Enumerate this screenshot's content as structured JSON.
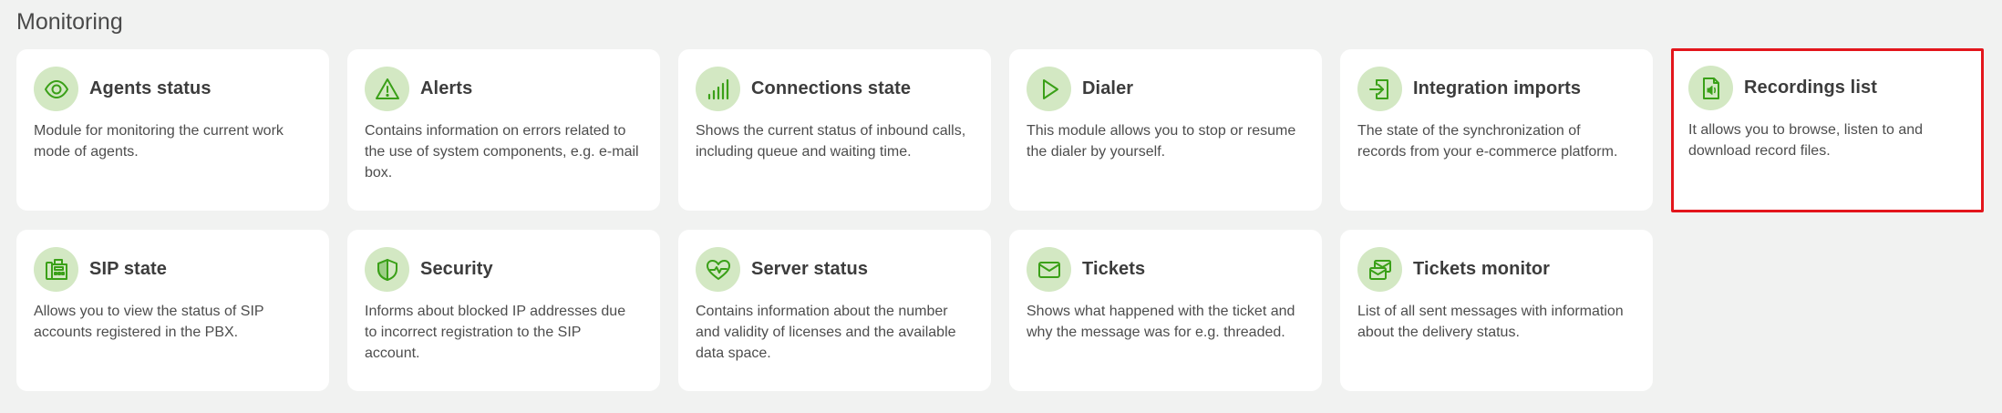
{
  "page": {
    "title": "Monitoring"
  },
  "accent_color": "#3aa018",
  "icon_bg_color": "#d3e8c3",
  "highlight_color": "#e3161c",
  "cards": [
    {
      "title": "Agents status",
      "icon": "eye-icon",
      "description": "Module for monitoring the current work mode of agents."
    },
    {
      "title": "Alerts",
      "icon": "warning-triangle-icon",
      "description": "Contains information on errors related to the use of system components, e.g. e-mail box."
    },
    {
      "title": "Connections state",
      "icon": "signal-bars-icon",
      "description": "Shows the current status of inbound calls, including queue and waiting time."
    },
    {
      "title": "Dialer",
      "icon": "play-icon",
      "description": "This module allows you to stop or resume the dialer by yourself."
    },
    {
      "title": "Integration imports",
      "icon": "import-icon",
      "description": "The state of the synchronization of records from your e-commerce platform."
    },
    {
      "title": "Recordings list",
      "icon": "audio-file-icon",
      "description": "It allows you to browse, listen to and download record files."
    },
    {
      "title": "SIP state",
      "icon": "fax-icon",
      "description": "Allows you to view the status of SIP accounts registered in the PBX."
    },
    {
      "title": "Security",
      "icon": "shield-icon",
      "description": "Informs about blocked IP addresses due to incorrect registration to the SIP account."
    },
    {
      "title": "Server status",
      "icon": "heart-pulse-icon",
      "description": "Contains information about the number and validity of licenses and the available data space."
    },
    {
      "title": "Tickets",
      "icon": "envelope-icon",
      "description": "Shows what happened with the ticket and why the message was for e.g. threaded."
    },
    {
      "title": "Tickets monitor",
      "icon": "envelope-monitor-icon",
      "description": "List of all sent messages with information about the delivery status."
    }
  ]
}
